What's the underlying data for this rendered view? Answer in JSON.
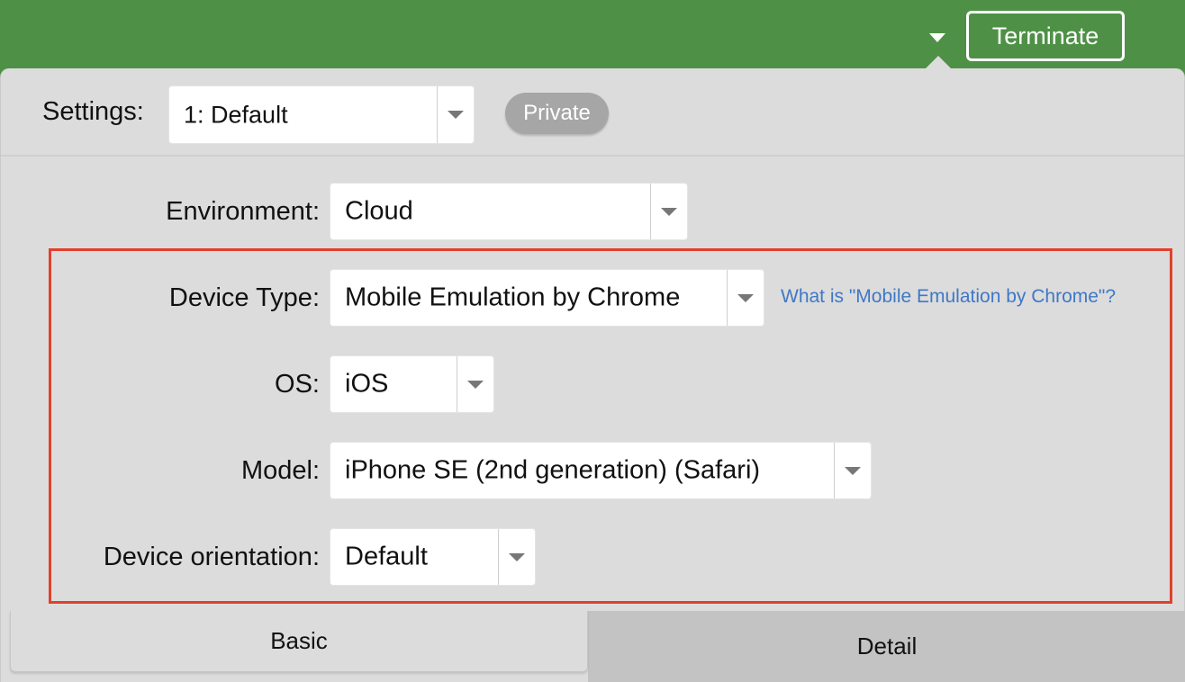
{
  "topbar": {
    "terminate_label": "Terminate",
    "dropdown_icon": "caret-down-icon"
  },
  "settings": {
    "label": "Settings:",
    "selected": "1: Default",
    "private_badge": "Private"
  },
  "form": {
    "environment": {
      "label": "Environment:",
      "value": "Cloud"
    },
    "device_type": {
      "label": "Device Type:",
      "value": "Mobile Emulation by Chrome",
      "help_link": "What is \"Mobile Emulation by Chrome\"?"
    },
    "os": {
      "label": "OS:",
      "value": "iOS"
    },
    "model": {
      "label": "Model:",
      "value": "iPhone SE (2nd generation) (Safari)"
    },
    "orientation": {
      "label": "Device orientation:",
      "value": "Default"
    }
  },
  "tabs": [
    {
      "label": "Basic",
      "active": true
    },
    {
      "label": "Detail",
      "active": false
    }
  ],
  "colors": {
    "header_green": "#4e9146",
    "highlight_red": "#e2402c",
    "link_blue": "#3f78c6",
    "panel_gray": "#dcdcdc"
  }
}
